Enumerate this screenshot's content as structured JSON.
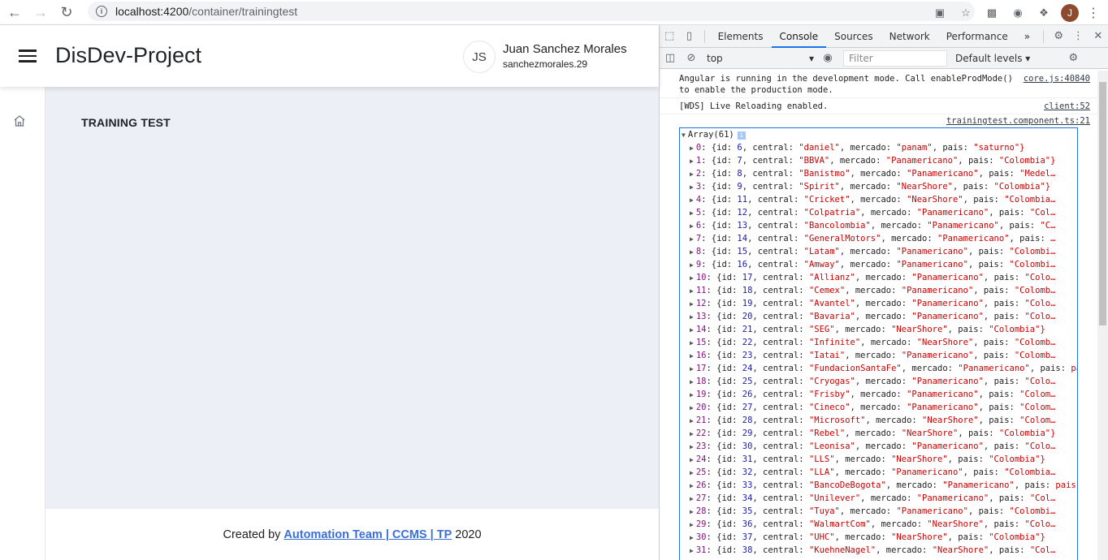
{
  "browser": {
    "url_host": "localhost:4200",
    "url_path": "/container/trainingtest",
    "profile_initial": "J"
  },
  "app": {
    "title": "DisDev-Project",
    "user_initials": "JS",
    "user_name": "Juan Sanchez Morales",
    "user_handle": "sanchezmorales.29",
    "page_heading": "TRAINING TEST",
    "footer_prefix": "Created by",
    "footer_link": "Automation Team | CCMS | TP",
    "footer_year": "2020"
  },
  "devtools": {
    "tabs": [
      "Elements",
      "Console",
      "Sources",
      "Network",
      "Performance"
    ],
    "active_tab": "Console",
    "more": "»",
    "context": "top",
    "filter_placeholder": "Filter",
    "levels": "Default levels ▾",
    "messages": [
      {
        "text": "Angular is running in the development mode. Call enableProdMode() to enable the production mode.",
        "source": "core.js:40840"
      },
      {
        "text": "[WDS] Live Reloading enabled.",
        "source": "client:52"
      }
    ],
    "log_source": "trainingtest.component.ts:21",
    "array_label": "Array(61)",
    "rows": [
      {
        "i": "0",
        "id": "6",
        "central": "\"daniel\"",
        "mercado": "\"panam\"",
        "pais": "\"saturno\"}"
      },
      {
        "i": "1",
        "id": "7",
        "central": "\"BBVA\"",
        "mercado": "\"Panamericano\"",
        "pais": "\"Colombia\"}"
      },
      {
        "i": "2",
        "id": "8",
        "central": "\"Banistmo\"",
        "mercado": "\"Panamericano\"",
        "pais": "\"Medel…"
      },
      {
        "i": "3",
        "id": "9",
        "central": "\"Spirit\"",
        "mercado": "\"NearShore\"",
        "pais": "\"Colombia\"}"
      },
      {
        "i": "4",
        "id": "11",
        "central": "\"Cricket\"",
        "mercado": "\"NearShore\"",
        "pais": "\"Colombia…"
      },
      {
        "i": "5",
        "id": "12",
        "central": "\"Colpatria\"",
        "mercado": "\"Panamericano\"",
        "pais": "\"Col…"
      },
      {
        "i": "6",
        "id": "13",
        "central": "\"Bancolombia\"",
        "mercado": "\"Panamericano\"",
        "pais": "\"C…"
      },
      {
        "i": "7",
        "id": "14",
        "central": "\"GeneralMotors\"",
        "mercado": "\"Panamericano\"",
        "pais": "…"
      },
      {
        "i": "8",
        "id": "15",
        "central": "\"Latam\"",
        "mercado": "\"Panamericano\"",
        "pais": "\"Colombi…"
      },
      {
        "i": "9",
        "id": "16",
        "central": "\"Amway\"",
        "mercado": "\"Panamericano\"",
        "pais": "\"Colombi…"
      },
      {
        "i": "10",
        "id": "17",
        "central": "\"Allianz\"",
        "mercado": "\"Panamericano\"",
        "pais": "\"Colo…"
      },
      {
        "i": "11",
        "id": "18",
        "central": "\"Cemex\"",
        "mercado": "\"Panamericano\"",
        "pais": "\"Colomb…"
      },
      {
        "i": "12",
        "id": "19",
        "central": "\"Avantel\"",
        "mercado": "\"Panamericano\"",
        "pais": "\"Colo…"
      },
      {
        "i": "13",
        "id": "20",
        "central": "\"Bavaria\"",
        "mercado": "\"Panamericano\"",
        "pais": "\"Colo…"
      },
      {
        "i": "14",
        "id": "21",
        "central": "\"SEG\"",
        "mercado": "\"NearShore\"",
        "pais": "\"Colombia\"}"
      },
      {
        "i": "15",
        "id": "22",
        "central": "\"Infinite\"",
        "mercado": "\"NearShore\"",
        "pais": "\"Colomb…"
      },
      {
        "i": "16",
        "id": "23",
        "central": "\"Iatai\"",
        "mercado": "\"Panamericano\"",
        "pais": "\"Colomb…"
      },
      {
        "i": "17",
        "id": "24",
        "central": "\"FundacionSantaFe\"",
        "mercado": "\"Panamericano\"",
        "pais": "pa…"
      },
      {
        "i": "18",
        "id": "25",
        "central": "\"Cryogas\"",
        "mercado": "\"Panamericano\"",
        "pais": "\"Colo…"
      },
      {
        "i": "19",
        "id": "26",
        "central": "\"Frisby\"",
        "mercado": "\"Panamericano\"",
        "pais": "\"Colom…"
      },
      {
        "i": "20",
        "id": "27",
        "central": "\"Cineco\"",
        "mercado": "\"Panamericano\"",
        "pais": "\"Colom…"
      },
      {
        "i": "21",
        "id": "28",
        "central": "\"Microsoft\"",
        "mercado": "\"NearShore\"",
        "pais": "\"Colom…"
      },
      {
        "i": "22",
        "id": "29",
        "central": "\"Rebel\"",
        "mercado": "\"NearShore\"",
        "pais": "\"Colombia\"}"
      },
      {
        "i": "23",
        "id": "30",
        "central": "\"Leonisa\"",
        "mercado": "\"Panamericano\"",
        "pais": "\"Colo…"
      },
      {
        "i": "24",
        "id": "31",
        "central": "\"LLS\"",
        "mercado": "\"NearShore\"",
        "pais": "\"Colombia\"}"
      },
      {
        "i": "25",
        "id": "32",
        "central": "\"LLA\"",
        "mercado": "\"Panamericano\"",
        "pais": "\"Colombia…"
      },
      {
        "i": "26",
        "id": "33",
        "central": "\"BancoDeBogota\"",
        "mercado": "\"Panamericano\"",
        "pais": "pais:…"
      },
      {
        "i": "27",
        "id": "34",
        "central": "\"Unilever\"",
        "mercado": "\"Panamericano\"",
        "pais": "\"Col…"
      },
      {
        "i": "28",
        "id": "35",
        "central": "\"Tuya\"",
        "mercado": "\"Panamericano\"",
        "pais": "\"Colombi…"
      },
      {
        "i": "29",
        "id": "36",
        "central": "\"WalmartCom\"",
        "mercado": "\"NearShore\"",
        "pais": "\"Colo…"
      },
      {
        "i": "30",
        "id": "37",
        "central": "\"UHC\"",
        "mercado": "\"NearShore\"",
        "pais": "\"Colombia\"}"
      },
      {
        "i": "31",
        "id": "38",
        "central": "\"KuehneNagel\"",
        "mercado": "\"NearShore\"",
        "pais": "\"Col…"
      }
    ]
  }
}
